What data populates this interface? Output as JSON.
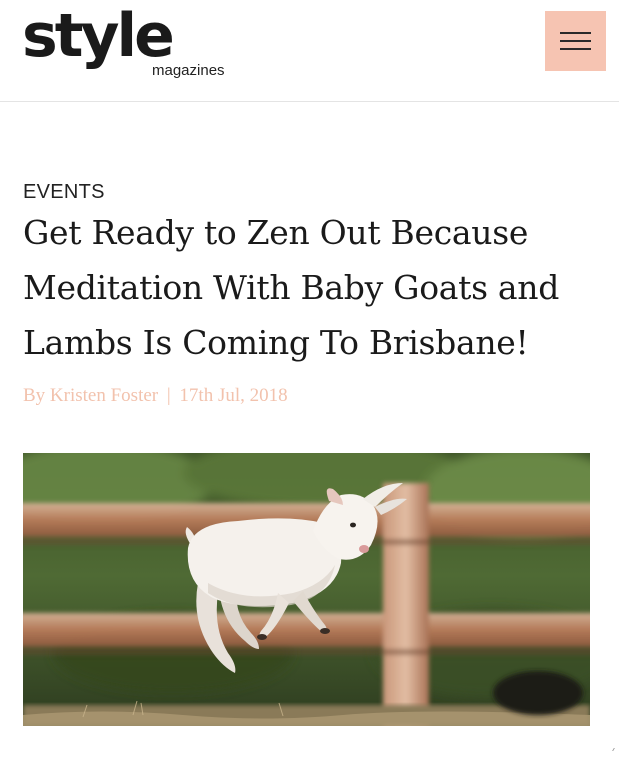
{
  "header": {
    "logo_word": "style",
    "logo_sub": "magazines",
    "menu_icon": "hamburger-menu-icon",
    "menu_color": "#f6c4b2"
  },
  "article": {
    "category": "EVENTS",
    "headline_lines": [
      "Get Ready to Zen Out Because",
      "Meditation With Baby Goats and",
      "Lambs Is Coming To Brisbane!"
    ],
    "byline": {
      "author": "By Kristen Foster",
      "separator": "|",
      "date": "17th Jul, 2018"
    },
    "byline_color": "#f2c2ad",
    "hero_image": "baby-goat-jumping-photo"
  }
}
